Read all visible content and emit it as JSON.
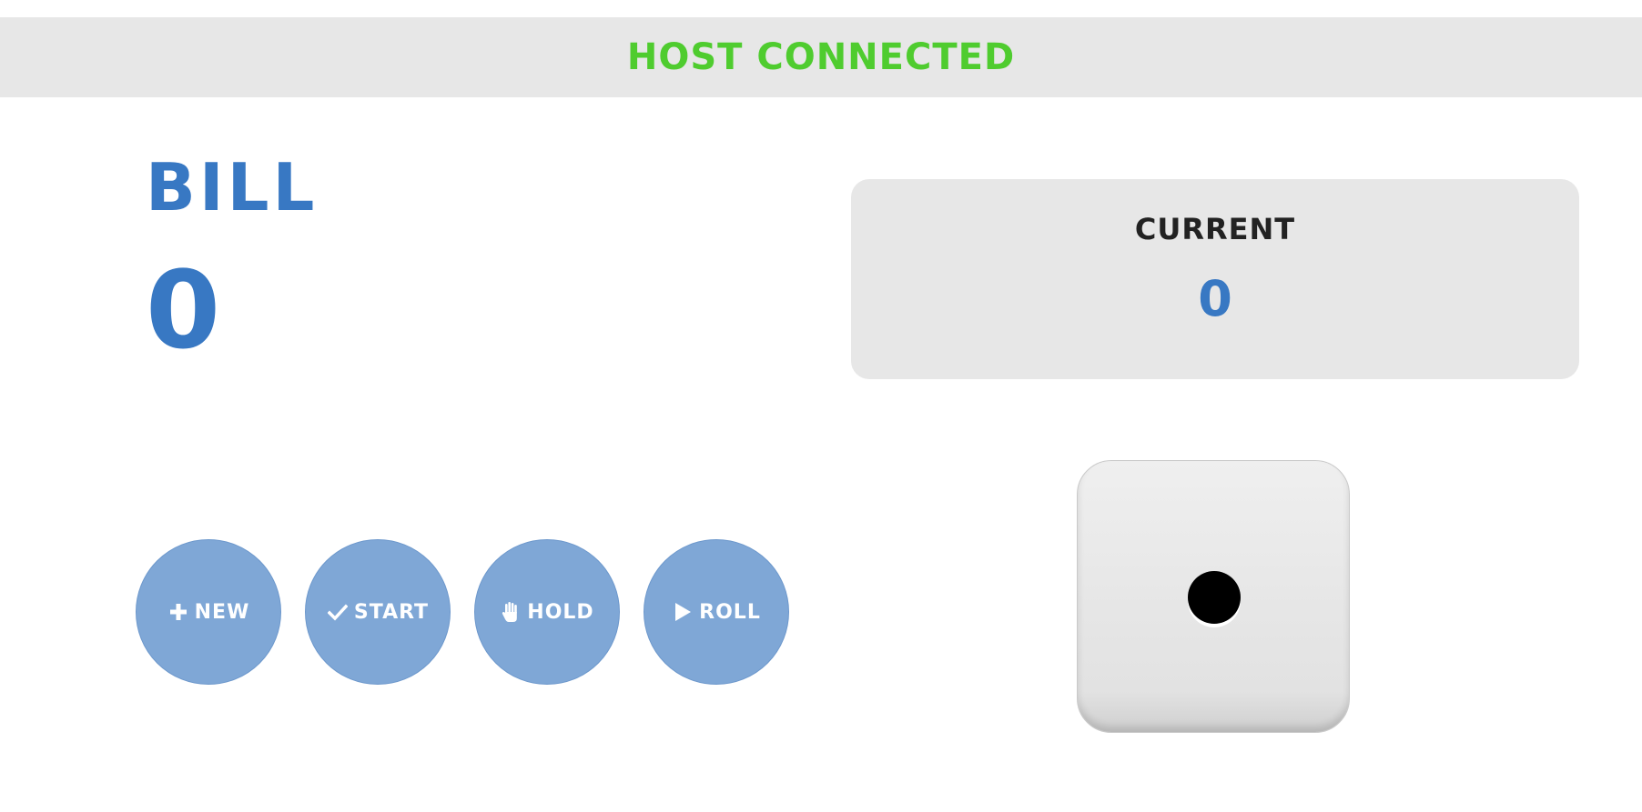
{
  "status": {
    "text": "HOST CONNECTED",
    "color": "#4fcc2f"
  },
  "player": {
    "name": "BILL",
    "score": "0"
  },
  "current": {
    "label": "CURRENT",
    "value": "0"
  },
  "controls": [
    {
      "icon": "plus-icon",
      "label": "NEW"
    },
    {
      "icon": "check-icon",
      "label": "START"
    },
    {
      "icon": "hand-icon",
      "label": "HOLD"
    },
    {
      "icon": "play-icon",
      "label": "ROLL"
    }
  ],
  "die": {
    "value": 1
  },
  "colors": {
    "accent": "#3878c3",
    "button": "#7fa7d6",
    "panel": "#e7e7e7"
  }
}
